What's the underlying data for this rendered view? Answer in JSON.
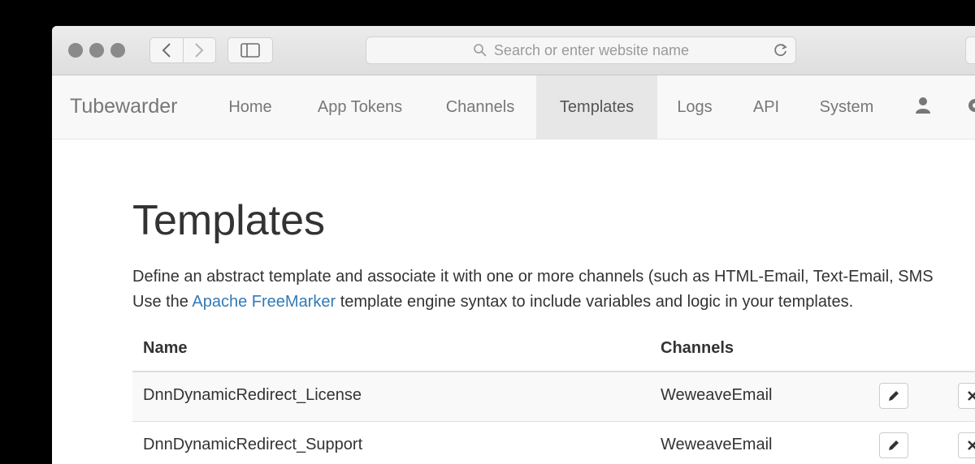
{
  "browser": {
    "address_placeholder": "Search or enter website name"
  },
  "navbar": {
    "brand": "Tubewarder",
    "items": [
      {
        "label": "Home"
      },
      {
        "label": "App Tokens"
      },
      {
        "label": "Channels"
      },
      {
        "label": "Templates",
        "active": true
      },
      {
        "label": "Logs"
      },
      {
        "label": "API"
      },
      {
        "label": "System"
      }
    ],
    "icons": [
      "user-icon",
      "gear-icon"
    ]
  },
  "page": {
    "title": "Templates",
    "description_line1": "Define an abstract template and associate it with one or more channels (such as HTML-Email, Text-Email, SMS",
    "description_line2_before": "Use the ",
    "description_link": "Apache FreeMarker",
    "description_line2_after": " template engine syntax to include variables and logic in your templates."
  },
  "table": {
    "columns": [
      "Name",
      "Channels"
    ],
    "rows": [
      {
        "name": "DnnDynamicRedirect_License",
        "channels": "WeweaveEmail"
      },
      {
        "name": "DnnDynamicRedirect_Support",
        "channels": "WeweaveEmail"
      }
    ],
    "row_icons": [
      "pencil-icon",
      "close-icon"
    ]
  },
  "colors": {
    "link": "#337ab7",
    "active_nav_bg": "#e7e7e7",
    "text": "#333333"
  }
}
